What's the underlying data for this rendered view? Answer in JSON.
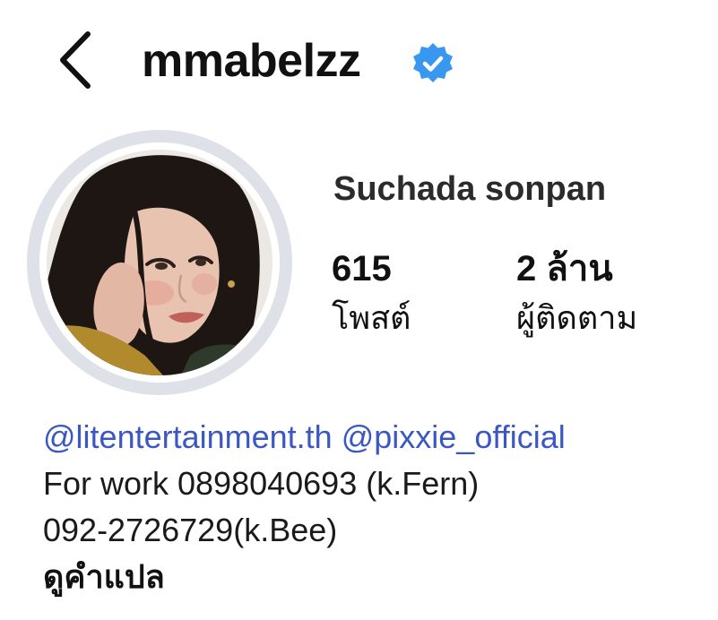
{
  "header": {
    "username": "mmabelzz",
    "back_icon": "chevron-left-icon",
    "verified_icon": "verified-badge-icon",
    "verified_color": "#3897f0"
  },
  "profile": {
    "full_name": "Suchada sonpan",
    "avatar_icon": "profile-photo",
    "stats": {
      "posts_value": "615",
      "posts_label": "โพสต์",
      "followers_value": "2 ล้าน",
      "followers_label": "ผู้ติดตาม"
    }
  },
  "bio": {
    "mention_1": "@litentertainment.th",
    "mention_2": "@pixxie_official",
    "line_2": "For work 0898040693 (k.Fern)",
    "line_3": "092-2726729(k.Bee)",
    "translate_label": "ดูคำแปล",
    "mention_color": "#3a57c4"
  }
}
